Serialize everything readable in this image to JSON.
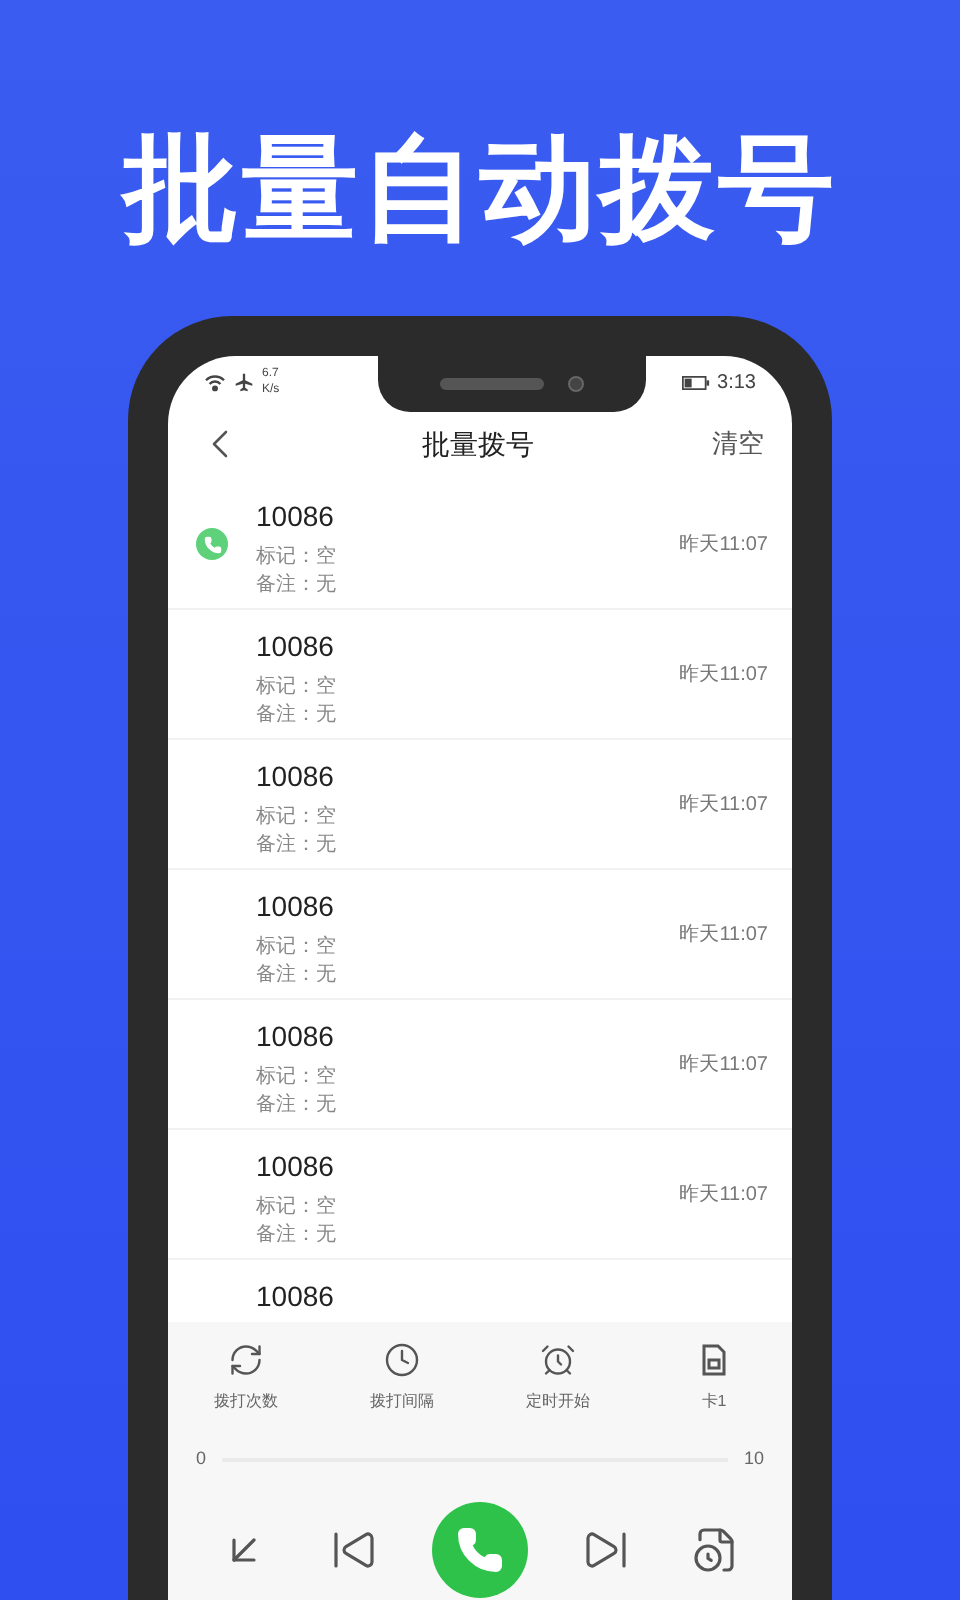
{
  "headline": "批量自动拨号",
  "status_bar": {
    "speed": "6.7",
    "speed_unit": "K/s",
    "time": "3:13"
  },
  "header": {
    "title": "批量拨号",
    "action": "清空"
  },
  "calls": [
    {
      "number": "10086",
      "mark": "标记：空",
      "note": "备注：无",
      "time": "昨天11:07",
      "calling": true
    },
    {
      "number": "10086",
      "mark": "标记：空",
      "note": "备注：无",
      "time": "昨天11:07",
      "calling": false
    },
    {
      "number": "10086",
      "mark": "标记：空",
      "note": "备注：无",
      "time": "昨天11:07",
      "calling": false
    },
    {
      "number": "10086",
      "mark": "标记：空",
      "note": "备注：无",
      "time": "昨天11:07",
      "calling": false
    },
    {
      "number": "10086",
      "mark": "标记：空",
      "note": "备注：无",
      "time": "昨天11:07",
      "calling": false
    },
    {
      "number": "10086",
      "mark": "标记：空",
      "note": "备注：无",
      "time": "昨天11:07",
      "calling": false
    },
    {
      "number": "10086",
      "calling": false
    }
  ],
  "options": [
    {
      "kind": "repeat",
      "label": "拨打次数"
    },
    {
      "kind": "interval",
      "label": "拨打间隔"
    },
    {
      "kind": "alarm",
      "label": "定时开始"
    },
    {
      "kind": "sim",
      "label": "卡1"
    }
  ],
  "range": {
    "min": "0",
    "max": "10"
  },
  "controls": [
    {
      "kind": "import"
    },
    {
      "kind": "previous"
    },
    {
      "kind": "call"
    },
    {
      "kind": "next"
    },
    {
      "kind": "schedule"
    }
  ]
}
